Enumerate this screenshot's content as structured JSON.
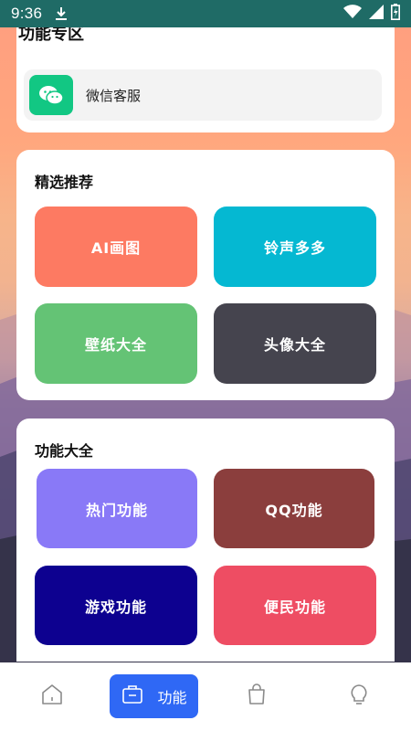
{
  "statusbar": {
    "time": "9:36"
  },
  "page": {
    "title": "功能专区"
  },
  "wechat": {
    "label": "微信客服"
  },
  "recommend": {
    "title": "精选推荐",
    "tiles": [
      {
        "label": "AI画图",
        "color": "#fd7a62"
      },
      {
        "label": "铃声多多",
        "color": "#05b8d2"
      },
      {
        "label": "壁纸大全",
        "color": "#64c375"
      },
      {
        "label": "头像大全",
        "color": "#45444e"
      }
    ]
  },
  "functions": {
    "title": "功能大全",
    "tiles": [
      {
        "label": "热门功能",
        "color": "#8979f7"
      },
      {
        "label": "QQ功能",
        "color": "#8b3e3d"
      },
      {
        "label": "游戏功能",
        "color": "#0d0190"
      },
      {
        "label": "便民功能",
        "color": "#ee4d63"
      }
    ]
  },
  "bottomnav": {
    "active_label": "功能",
    "accent": "#2f68f5",
    "items": [
      "home-icon",
      "briefcase-icon",
      "bag-icon",
      "lightbulb-icon"
    ]
  }
}
